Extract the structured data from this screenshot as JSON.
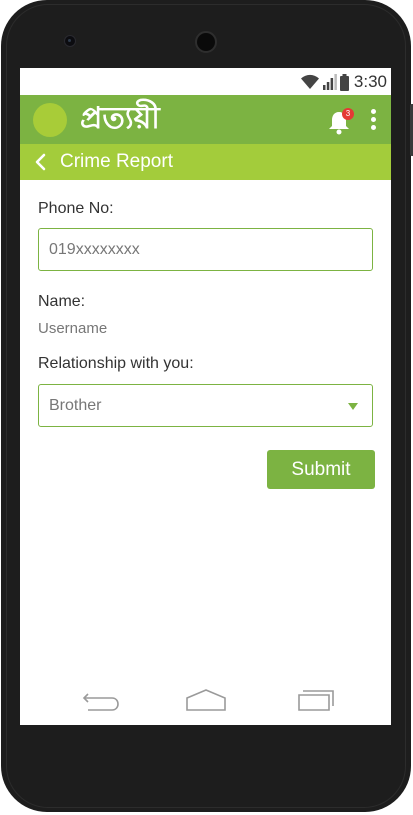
{
  "status_bar": {
    "time": "3:30"
  },
  "app_bar": {
    "logo_text": "প্রত্যয়ী",
    "notification_count": "3"
  },
  "sub_bar": {
    "title": "Crime Report"
  },
  "form": {
    "phone_label": "Phone No:",
    "phone_value": "019xxxxxxxx",
    "name_label": "Name:",
    "name_value": "Username",
    "relationship_label": "Relationship with you:",
    "relationship_value": "Brother",
    "submit_label": "Submit"
  },
  "colors": {
    "primary": "#7cb342",
    "secondary": "#a3cc3b",
    "avatar": "#a8cc38",
    "badge": "#e53935"
  }
}
